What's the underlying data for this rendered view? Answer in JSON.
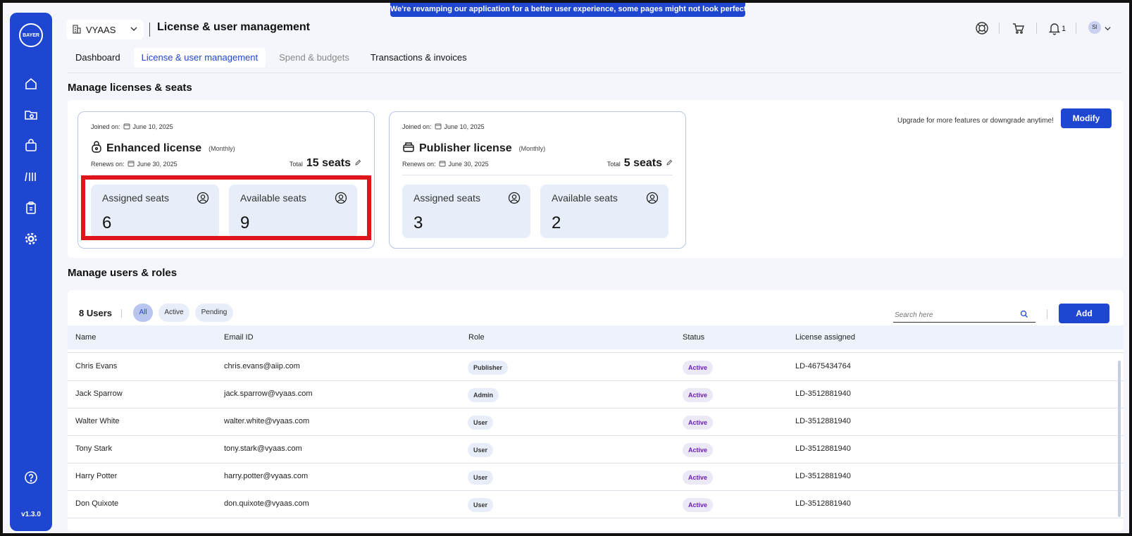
{
  "banner": "We're revamping our application for a better user experience, some pages might not look perfect yet!",
  "sidebar": {
    "logo_text_h": "BAYER",
    "logo_text_v": "BAYER",
    "items": [
      {
        "icon": "home-icon"
      },
      {
        "icon": "folder-icon"
      },
      {
        "icon": "shopping-bag-icon"
      },
      {
        "icon": "library-icon"
      },
      {
        "icon": "clipboard-icon"
      },
      {
        "icon": "gear-icon"
      }
    ],
    "help_icon": "help-icon",
    "version": "v1.3.0"
  },
  "header": {
    "workspace": "VYAAS",
    "title": "License & user management",
    "notification_count": "1",
    "avatar": "SI"
  },
  "tabs": [
    {
      "label": "Dashboard"
    },
    {
      "label": "License & user management"
    },
    {
      "label": "Spend & budgets"
    },
    {
      "label": "Transactions & invoices"
    }
  ],
  "licenses": {
    "section_title": "Manage licenses & seats",
    "upgrade_text": "Upgrade for more features or downgrade anytime!",
    "modify_label": "Modify",
    "cards": [
      {
        "joined_label": "Joined on:",
        "joined_date": "June 10, 2025",
        "name": "Enhanced license",
        "period": "(Monthly)",
        "renews_label": "Renews on:",
        "renews_date": "June 30, 2025",
        "total_label": "Total",
        "total_seats": "15 seats",
        "assigned_label": "Assigned seats",
        "assigned": "6",
        "available_label": "Available seats",
        "available": "9"
      },
      {
        "joined_label": "Joined on:",
        "joined_date": "June 10, 2025",
        "name": "Publisher license",
        "period": "(Monthly)",
        "renews_label": "Renews on:",
        "renews_date": "June 30, 2025",
        "total_label": "Total",
        "total_seats": "5 seats",
        "assigned_label": "Assigned seats",
        "assigned": "3",
        "available_label": "Available seats",
        "available": "2"
      }
    ]
  },
  "users": {
    "section_title": "Manage users & roles",
    "count": "8 Users",
    "filters": [
      "All",
      "Active",
      "Pending"
    ],
    "search_placeholder": "Search here",
    "add_label": "Add",
    "columns": [
      "Name",
      "Email ID",
      "Role",
      "Status",
      "License assigned"
    ],
    "rows": [
      {
        "name": "Chris Evans",
        "email": "chris.evans@aiip.com",
        "role": "Publisher",
        "status": "Active",
        "license": "LD-4675434764"
      },
      {
        "name": "Jack Sparrow",
        "email": "jack.sparrow@vyaas.com",
        "role": "Admin",
        "status": "Active",
        "license": "LD-3512881940"
      },
      {
        "name": "Walter White",
        "email": "walter.white@vyaas.com",
        "role": "User",
        "status": "Active",
        "license": "LD-3512881940"
      },
      {
        "name": "Tony Stark",
        "email": "tony.stark@vyaas.com",
        "role": "User",
        "status": "Active",
        "license": "LD-3512881940"
      },
      {
        "name": "Harry Potter",
        "email": "harry.potter@vyaas.com",
        "role": "User",
        "status": "Active",
        "license": "LD-3512881940"
      },
      {
        "name": "Don Quixote",
        "email": "don.quixote@vyaas.com",
        "role": "User",
        "status": "Active",
        "license": "LD-3512881940"
      }
    ]
  }
}
